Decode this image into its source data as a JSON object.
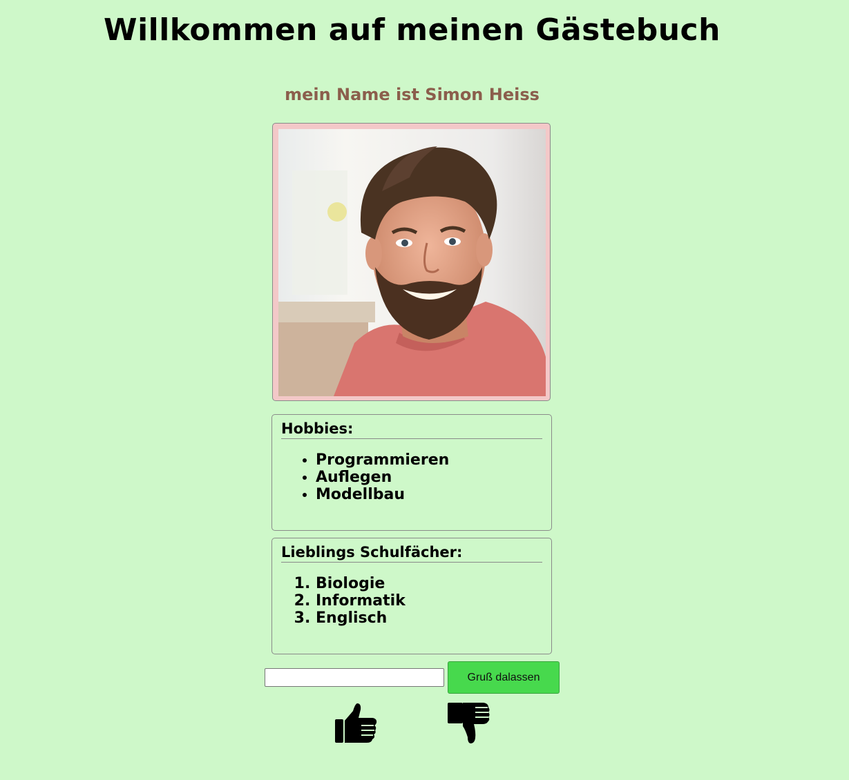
{
  "header": {
    "title": "Willkommen auf meinen Gästebuch",
    "subtitle": "mein Name ist Simon Heiss"
  },
  "profile": {
    "photo": "profile-photo"
  },
  "hobbies": {
    "title": "Hobbies:",
    "items": [
      "Programmieren",
      "Auflegen",
      "Modellbau"
    ]
  },
  "subjects": {
    "title": "Lieblings Schulfächer:",
    "items": [
      "Biologie",
      "Informatik",
      "Englisch"
    ]
  },
  "guestbook": {
    "input_value": "",
    "button_label": "Gruß dalassen"
  },
  "reactions": {
    "like_icon": "thumbs-up-icon",
    "dislike_icon": "thumbs-down-icon"
  },
  "colors": {
    "background": "#cef8c9",
    "subtitle": "#8b5e4c",
    "photo_frame": "#f3c8c8",
    "button": "#47d94d"
  }
}
